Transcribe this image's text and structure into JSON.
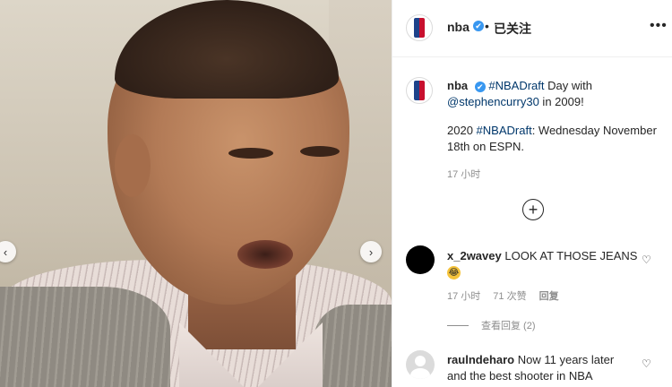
{
  "post": {
    "username": "nba",
    "verified_badge": "✔",
    "follow_separator": "•",
    "follow_status": "已关注",
    "more_icon": "•••",
    "caption": {
      "username": "nba",
      "hashtag1": "#NBADraft",
      "text1": " Day with",
      "mention": "@stephencurry30",
      "text2": " in 2009!",
      "line2_prefix": "2020 ",
      "hashtag2": "#NBADraft",
      "line2_text": ": Wednesday November 18th on ESPN."
    },
    "time": "17 小时",
    "add_comment_icon": "+"
  },
  "nav": {
    "prev": "‹",
    "next": "›"
  },
  "comments": [
    {
      "username": "x_2wavey",
      "text": "LOOK AT THOSE JEANS",
      "emoji": "😂",
      "time": "17 小时",
      "likes": "71 次赞",
      "reply": "回复",
      "view_replies": "查看回复 (2)",
      "heart": "♡"
    },
    {
      "username": "raulndeharo",
      "text": "Now 11 years later and the best shooter in NBA",
      "heart": "♡"
    }
  ],
  "colors": {
    "verified": "#3897f0",
    "link": "#00376b",
    "muted": "#8e8e8e",
    "nba_blue": "#1d428a",
    "nba_red": "#c8102e"
  }
}
